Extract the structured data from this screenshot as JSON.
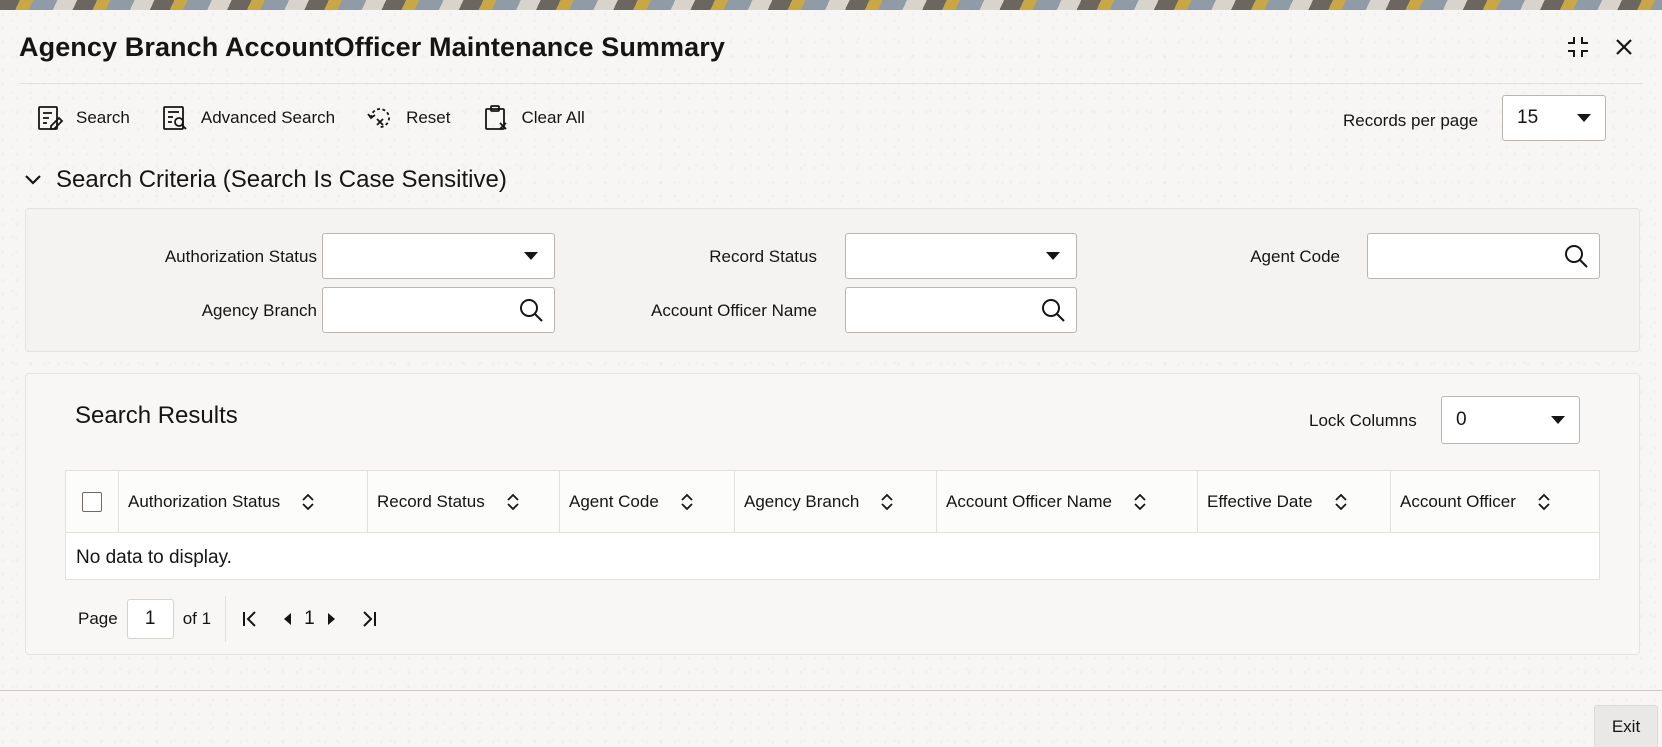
{
  "window": {
    "title": "Agency Branch AccountOfficer Maintenance Summary"
  },
  "toolbar": {
    "search_label": "Search",
    "advanced_search_label": "Advanced Search",
    "reset_label": "Reset",
    "clear_all_label": "Clear All",
    "records_per_page_label": "Records per page",
    "records_per_page_value": "15"
  },
  "criteria": {
    "section_title": "Search Criteria (Search Is Case Sensitive)",
    "authorization_status_label": "Authorization Status",
    "authorization_status_value": "",
    "record_status_label": "Record Status",
    "record_status_value": "",
    "agent_code_label": "Agent Code",
    "agent_code_value": "",
    "agency_branch_label": "Agency Branch",
    "agency_branch_value": "",
    "account_officer_name_label": "Account Officer Name",
    "account_officer_name_value": ""
  },
  "results": {
    "title": "Search Results",
    "lock_columns_label": "Lock Columns",
    "lock_columns_value": "0",
    "columns": [
      "Authorization Status",
      "Record Status",
      "Agent Code",
      "Agency Branch",
      "Account Officer Name",
      "Effective Date",
      "Account Officer"
    ],
    "empty_message": "No data to display."
  },
  "pager": {
    "page_label": "Page",
    "current_page": "1",
    "of_label": "of 1",
    "page_number": "1"
  },
  "footer": {
    "exit_label": "Exit"
  }
}
